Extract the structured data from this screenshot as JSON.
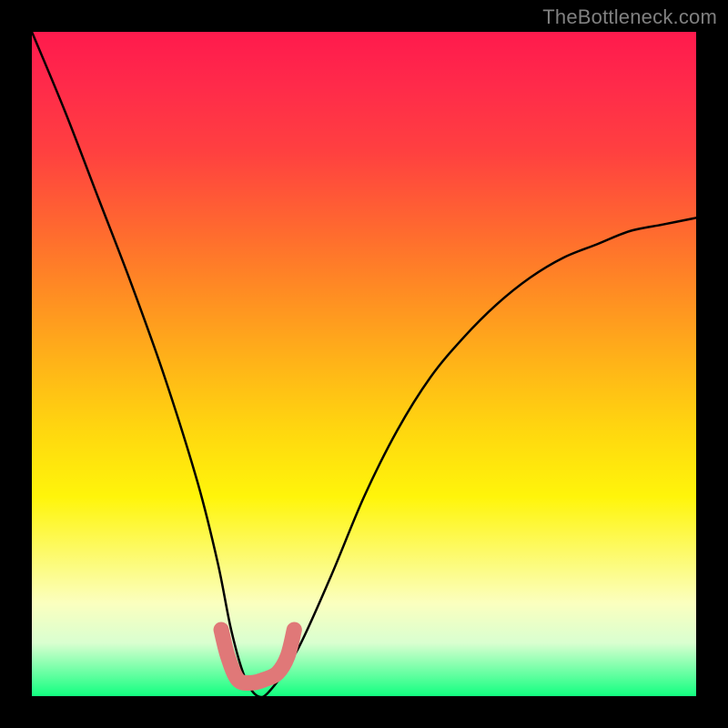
{
  "watermark": "TheBottleneck.com",
  "chart_data": {
    "type": "line",
    "title": "",
    "xlabel": "",
    "ylabel": "",
    "xlim": [
      0,
      100
    ],
    "ylim": [
      0,
      100
    ],
    "series": [
      {
        "name": "bottleneck-curve",
        "x": [
          0,
          5,
          10,
          15,
          20,
          25,
          28,
          30,
          32,
          34,
          36,
          40,
          45,
          50,
          55,
          60,
          65,
          70,
          75,
          80,
          85,
          90,
          95,
          100
        ],
        "values": [
          100,
          88,
          75,
          62,
          48,
          32,
          20,
          10,
          3,
          0,
          1,
          7,
          18,
          30,
          40,
          48,
          54,
          59,
          63,
          66,
          68,
          70,
          71,
          72
        ]
      },
      {
        "name": "trough-marker",
        "x": [
          28.5,
          29.5,
          31,
          33,
          35,
          37,
          38.5,
          39.5
        ],
        "values": [
          10,
          6,
          2.5,
          2,
          2.5,
          3.5,
          6,
          10
        ]
      }
    ],
    "background_gradient": {
      "top": "#ff1a4d",
      "mid": "#fff50a",
      "bottom": "#12ff80"
    }
  }
}
